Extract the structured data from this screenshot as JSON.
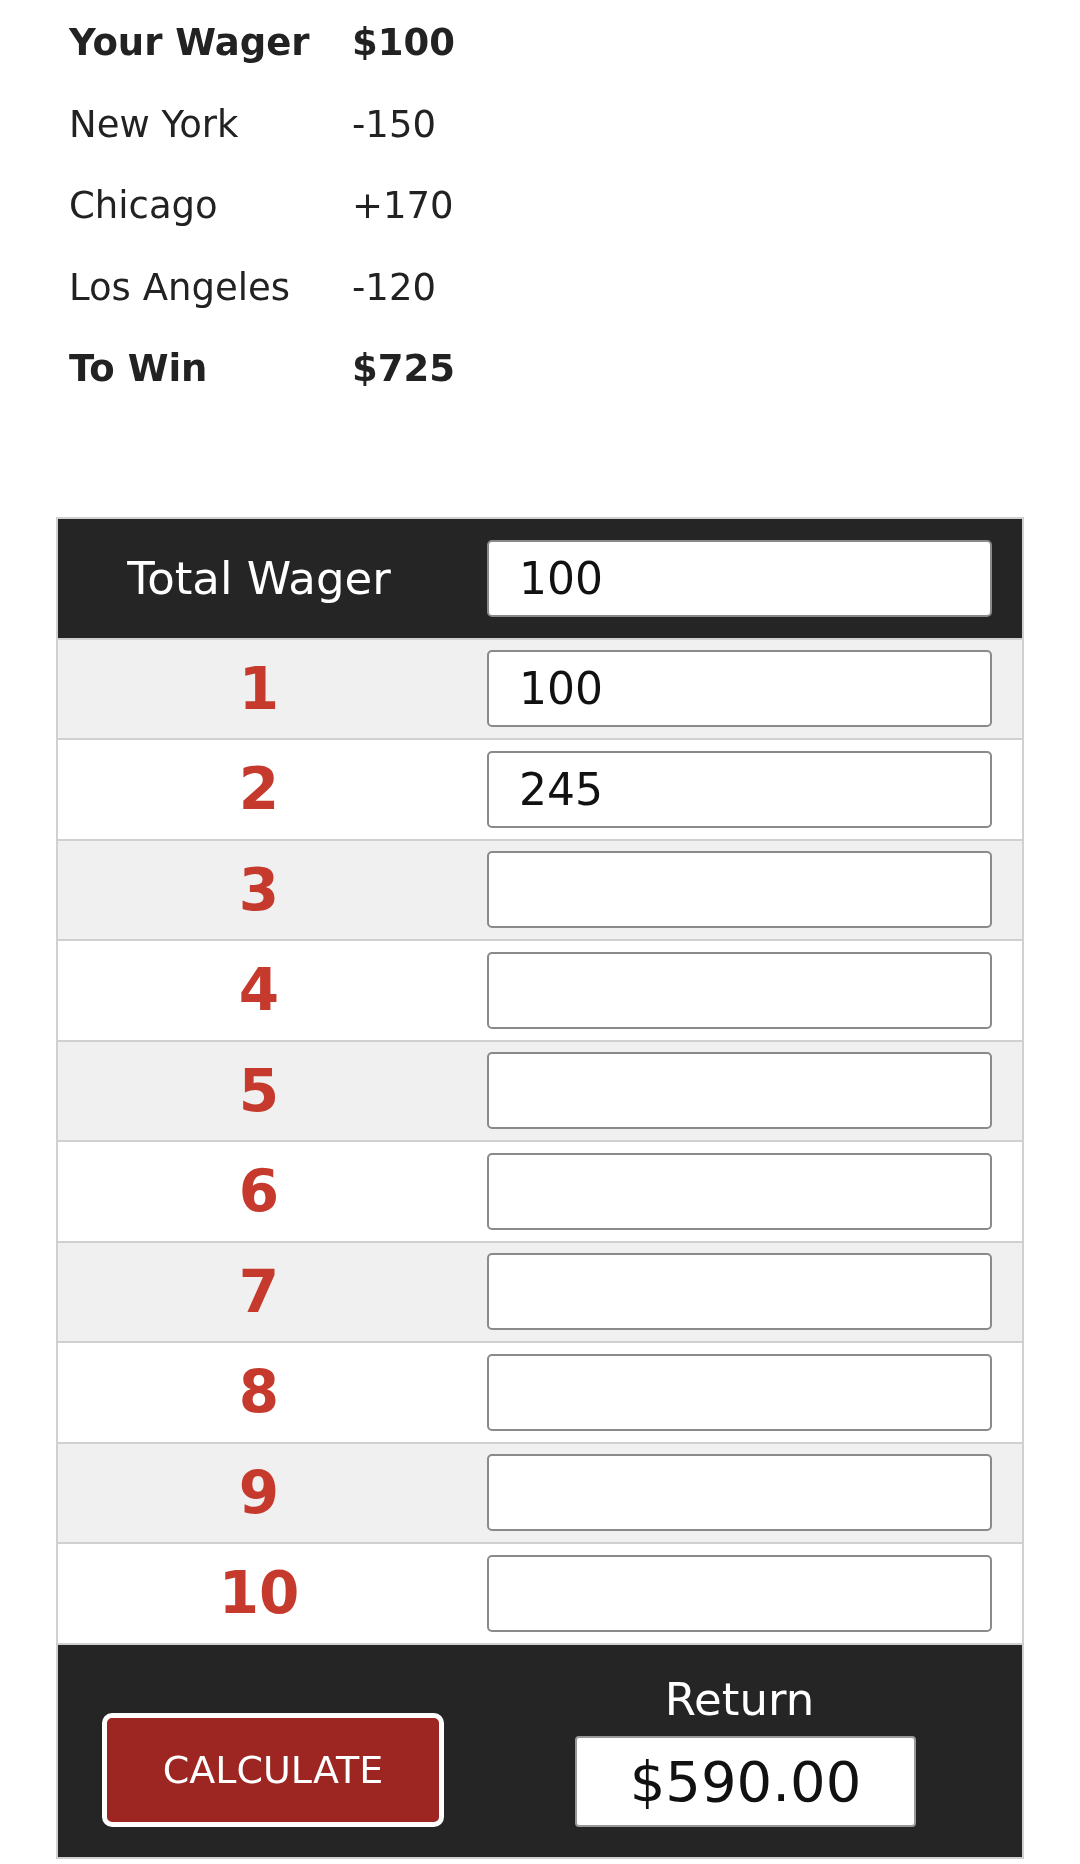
{
  "summary": [
    {
      "label": "Your Wager",
      "value": "$100",
      "bold": true
    },
    {
      "label": "New York",
      "value": "-150",
      "bold": false
    },
    {
      "label": "Chicago",
      "value": "+170",
      "bold": false
    },
    {
      "label": "Los Angeles",
      "value": "-120",
      "bold": false
    },
    {
      "label": "To Win",
      "value": "$725",
      "bold": true
    }
  ],
  "calculator": {
    "total_wager": {
      "label": "Total Wager",
      "value": "100"
    },
    "legs": [
      {
        "number": "1",
        "value": "100"
      },
      {
        "number": "2",
        "value": "245"
      },
      {
        "number": "3"
      },
      {
        "number": "4"
      },
      {
        "number": "5"
      },
      {
        "number": "6"
      },
      {
        "number": "7"
      },
      {
        "number": "8"
      },
      {
        "number": "9"
      },
      {
        "number": "10"
      }
    ],
    "calculate_button": "CALCULATE",
    "return": {
      "label": "Return",
      "value": "$590.00"
    }
  }
}
